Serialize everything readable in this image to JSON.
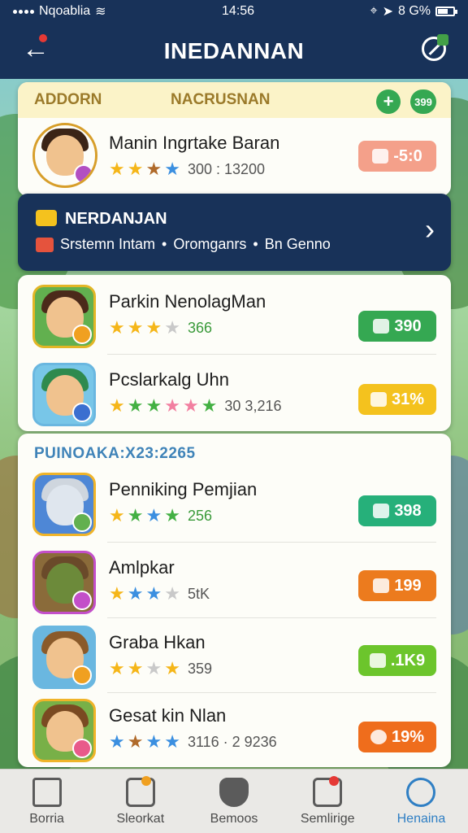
{
  "status_bar": {
    "carrier": "Nqoablia",
    "time": "14:56",
    "battery": "8 G%"
  },
  "header": {
    "title": "INEDANNAN"
  },
  "top_card": {
    "label_left": "ADDORN",
    "label_center": "NACRUSNAN",
    "plus_label": "+",
    "count": "399",
    "row": {
      "name": "Manin Ingrtake Baran",
      "stars": [
        "gold",
        "gold",
        "brown",
        "blue"
      ],
      "meta": "300 : 13200",
      "price": "-5:0",
      "price_color": "#f4a08a"
    }
  },
  "banner": {
    "title": "NERDANJAN",
    "crumbs": [
      "Srstemn Intam",
      "Oromganrs",
      "Bn Genno"
    ],
    "separator": "•"
  },
  "list1": [
    {
      "name": "Parkin NenolagMan",
      "stars": [
        "gold",
        "gold",
        "gold",
        "grey"
      ],
      "meta": "366",
      "price": "390",
      "pill": "green"
    },
    {
      "name": "Pcslarkalg Uhn",
      "stars": [
        "gold",
        "green",
        "green",
        "pink",
        "pink",
        "green"
      ],
      "meta": "30 3,216",
      "price": "31%",
      "pill": "yellow"
    }
  ],
  "section": {
    "title": "PUINOAKA:X23:2265"
  },
  "list2": [
    {
      "name": "Penniking Pemjian",
      "stars": [
        "gold",
        "green",
        "blue",
        "green"
      ],
      "meta": "256",
      "price": "398",
      "pill": "teal"
    },
    {
      "name": "Amlpkar",
      "stars": [
        "gold",
        "blue",
        "blue",
        "grey"
      ],
      "meta": "5tK",
      "price": "199",
      "pill": "orange"
    },
    {
      "name": "Graba Hkan",
      "stars": [
        "gold",
        "gold",
        "grey",
        "gold"
      ],
      "meta": "359",
      "price": ".1K9",
      "pill": "lime"
    },
    {
      "name": "Gesat kin Nlan",
      "stars": [
        "blue",
        "brown",
        "blue",
        "blue"
      ],
      "meta": "3116 · 2 9236",
      "price": "19%",
      "pill": "red"
    }
  ],
  "bottom_nav": [
    {
      "label": "Borria",
      "icon": "home-icon"
    },
    {
      "label": "Sleorkat",
      "icon": "store-icon"
    },
    {
      "label": "Bemoos",
      "icon": "shield-icon"
    },
    {
      "label": "Semlirige",
      "icon": "settings-icon"
    },
    {
      "label": "Henaina",
      "icon": "profile-icon"
    }
  ],
  "colors": {
    "header_bg": "#183259",
    "accent_green": "#35a852",
    "section_blue": "#3f83b8",
    "active_nav": "#2f7fc4"
  }
}
